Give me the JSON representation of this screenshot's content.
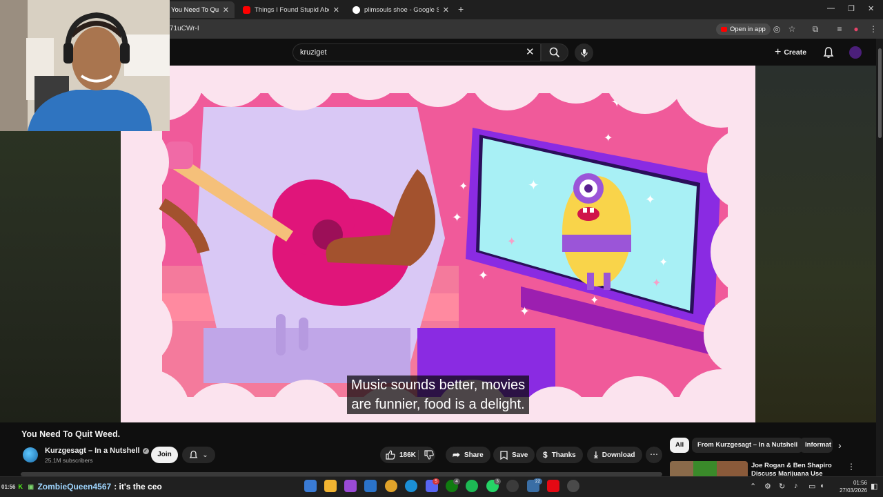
{
  "browser": {
    "tabs": [
      {
        "title": "You Need To Quit Weed. - YouTube",
        "active": true,
        "favicon": "youtube-icon"
      },
      {
        "title": "Things I Found Stupid About Sm",
        "active": false,
        "favicon": "youtube-icon"
      },
      {
        "title": "plimsouls shoe - Google Search",
        "active": false,
        "favicon": "google-icon"
      }
    ],
    "tab_close": "✕",
    "new_tab": "+",
    "url_fragment": "71uCWr-I",
    "open_in_app": "Open in app"
  },
  "youtube": {
    "search_value": "kruziget",
    "create_label": "Create"
  },
  "video": {
    "caption_line1": "Music sounds better, movies",
    "caption_line2": "are funnier, food is a delight.",
    "title": "You Need To Quit Weed."
  },
  "channel": {
    "name": "Kurzgesagt – In a Nutshell",
    "subscribers": "25.1M subscribers",
    "join_label": "Join"
  },
  "actions": {
    "likes": "186K",
    "share": "Share",
    "save": "Save",
    "thanks": "Thanks",
    "download": "Download",
    "more": "⋯"
  },
  "chips": [
    "All",
    "From Kurzgesagt – In a Nutshell",
    "Informat"
  ],
  "recommendation": {
    "title": "Joe Rogan & Ben Shapiro Discuss Marijuana Use"
  },
  "taskbar": {
    "chat_time": "01:56",
    "chat_user": "ZombieQueen4567",
    "chat_message": ": it's the ceo",
    "badges": {
      "teams": "4",
      "whatsapp": "3",
      "discord": "5",
      "chat": "22"
    },
    "clock_time": "01:56",
    "clock_date": "27/03/2026"
  },
  "colors": {
    "background": "#0f0f0f",
    "pill": "#272727",
    "youtube_red": "#ff0000",
    "video_pink": "#fbe3ee",
    "magenta": "#e0157a",
    "purple": "#8a2be2"
  }
}
